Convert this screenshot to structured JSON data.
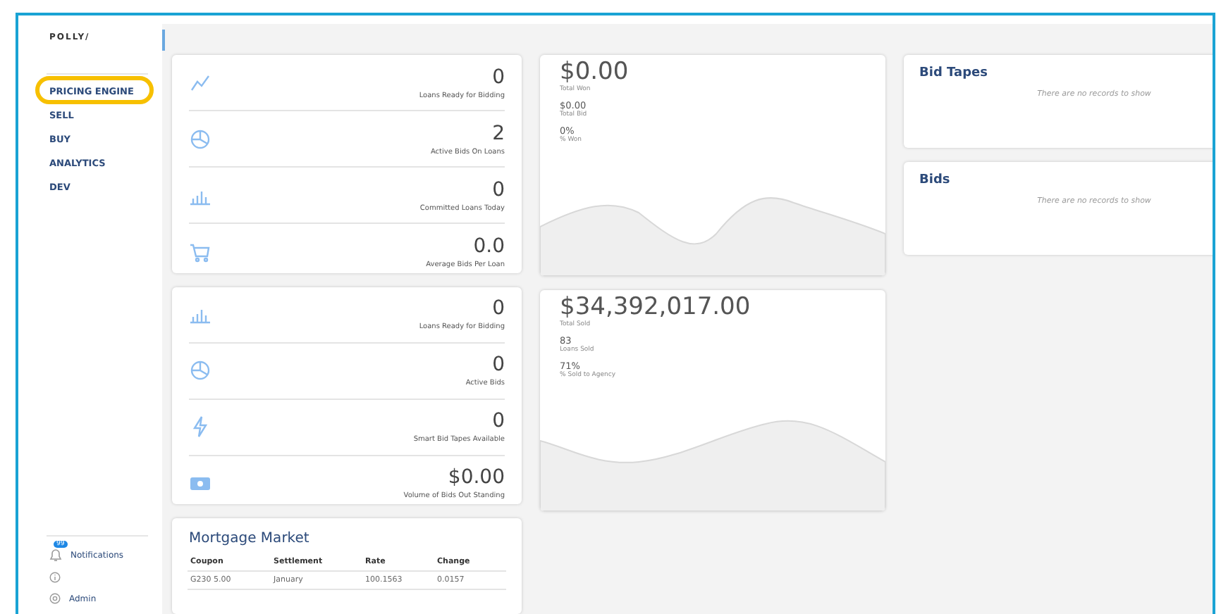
{
  "sidebar": {
    "logo": "POLLY/",
    "nav_items": [
      {
        "label": "PRICING ENGINE",
        "highlighted": true
      },
      {
        "label": "SELL",
        "highlighted": false
      },
      {
        "label": "BUY",
        "highlighted": false
      },
      {
        "label": "ANALYTICS",
        "highlighted": false
      },
      {
        "label": "DEV",
        "highlighted": false
      }
    ],
    "notifications": {
      "badge": "99",
      "label": "Notifications"
    },
    "admin": {
      "label": "Admin"
    }
  },
  "stat_cards": [
    {
      "rows": [
        {
          "value": "0",
          "label": "Loans Ready for Bidding"
        },
        {
          "value": "2",
          "label": "Active Bids On Loans"
        },
        {
          "value": "0",
          "label": "Committed Loans Today"
        },
        {
          "value": "0.0",
          "label": "Average Bids Per Loan"
        }
      ]
    },
    {
      "rows": [
        {
          "value": "0",
          "label": "Loans Ready for Bidding"
        },
        {
          "value": "0",
          "label": "Active Bids"
        },
        {
          "value": "0",
          "label": "Smart Bid Tapes Available"
        },
        {
          "value": "$0.00",
          "label": "Volume of Bids Out Standing"
        }
      ]
    }
  ],
  "summary_cards": [
    {
      "value": "$0.00",
      "label": "Total Won",
      "metrics": [
        {
          "value": "$0.00",
          "label": "Total Bid"
        },
        {
          "value": "0%",
          "label": "% Won"
        }
      ]
    },
    {
      "value": "$34,392,017.00",
      "label": "Total Sold",
      "metrics": [
        {
          "value": "83",
          "label": "Loans Sold"
        },
        {
          "value": "71%",
          "label": "% Sold to Agency"
        }
      ]
    }
  ],
  "record_panels": [
    {
      "title": "Bid Tapes",
      "empty_text": "There are no records to show"
    },
    {
      "title": "Bids",
      "empty_text": "There are no records to show"
    }
  ],
  "mortgage_market": {
    "title": "Mortgage Market",
    "columns": [
      "Coupon",
      "Settlement",
      "Rate",
      "Change"
    ],
    "rows": [
      [
        "G230 5.00",
        "January",
        "100.1563",
        "0.0157"
      ]
    ]
  }
}
